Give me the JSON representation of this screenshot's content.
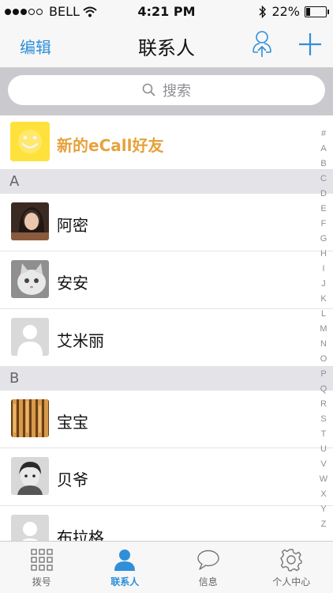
{
  "status": {
    "carrier": "BELL",
    "time": "4:21 PM",
    "battery": "22%",
    "battery_level": 0.22
  },
  "nav": {
    "edit": "编辑",
    "title": "联系人"
  },
  "search": {
    "placeholder": "搜索"
  },
  "new_friend": {
    "label": "新的eCall好友"
  },
  "sections": [
    {
      "letter": "A",
      "contacts": [
        "阿密",
        "安安",
        "艾米丽"
      ]
    },
    {
      "letter": "B",
      "contacts": [
        "宝宝",
        "贝爷",
        "布拉格"
      ]
    }
  ],
  "index": [
    "#",
    "A",
    "B",
    "C",
    "D",
    "E",
    "F",
    "G",
    "H",
    "I",
    "J",
    "K",
    "L",
    "M",
    "N",
    "O",
    "P",
    "Q",
    "R",
    "S",
    "T",
    "U",
    "V",
    "W",
    "X",
    "Y",
    "Z"
  ],
  "tabs": [
    {
      "label": "拨号",
      "icon": "dialpad-icon"
    },
    {
      "label": "联系人",
      "icon": "person-icon"
    },
    {
      "label": "信息",
      "icon": "chat-bubble-icon"
    },
    {
      "label": "个人中心",
      "icon": "gear-icon"
    }
  ],
  "colors": {
    "accent": "#2f8fd8",
    "new_friend": "#e6a23c",
    "smiley_bg": "#ffe13b"
  }
}
